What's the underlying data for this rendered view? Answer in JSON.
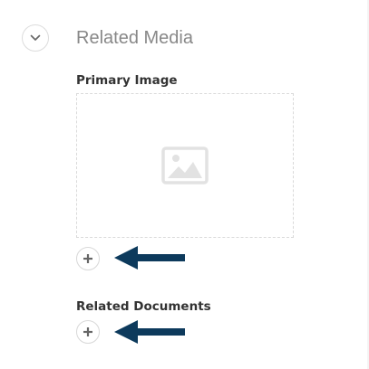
{
  "section": {
    "title": "Related Media",
    "toggle_icon": "chevron-down-icon"
  },
  "primary_image": {
    "label": "Primary Image",
    "placeholder_icon": "image-placeholder-icon",
    "add_icon": "plus-icon"
  },
  "related_documents": {
    "label": "Related Documents",
    "add_icon": "plus-icon"
  },
  "annotations": {
    "arrow_color": "#0d3a5c",
    "arrow_icon": "arrow-left-icon"
  },
  "colors": {
    "title": "#888888",
    "label": "#333333",
    "border": "#d8d8d8",
    "placeholder_icon": "#e2e2e2",
    "plus": "#666666"
  }
}
